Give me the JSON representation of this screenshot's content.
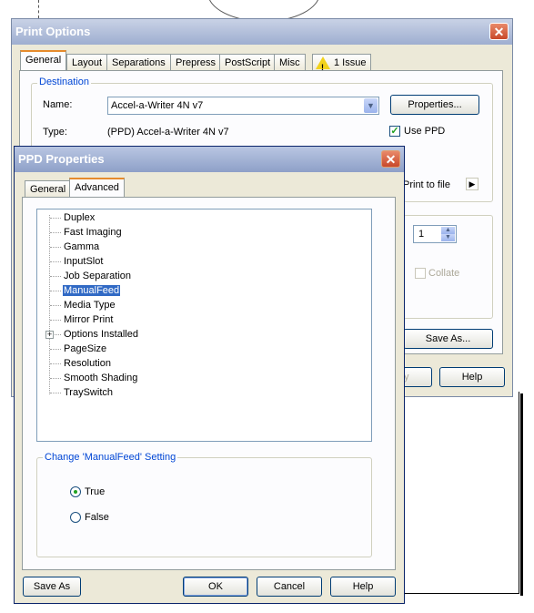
{
  "print_options": {
    "title": "Print Options",
    "tabs": [
      "General",
      "Layout",
      "Separations",
      "Prepress",
      "PostScript",
      "Misc"
    ],
    "issue_tab": "1 Issue",
    "destination": {
      "legend": "Destination",
      "name_label": "Name:",
      "name_value": "Accel-a-Writer 4N v7",
      "type_label": "Type:",
      "type_value": "(PPD) Accel-a-Writer 4N v7",
      "properties_button": "Properties...",
      "use_ppd_label": "Use PPD",
      "use_ppd_checked": true,
      "print_to_file_label": "Print to file"
    },
    "copies_value": "1",
    "collate_label": "Collate",
    "save_as_button": "Save As...",
    "partial_button": "y",
    "help_button": "Help"
  },
  "ppd_properties": {
    "title": "PPD Properties",
    "tabs": [
      "General",
      "Advanced"
    ],
    "selected_tab": "Advanced",
    "tree_items": [
      {
        "label": "Duplex",
        "expandable": false,
        "selected": false
      },
      {
        "label": "Fast Imaging",
        "expandable": false,
        "selected": false
      },
      {
        "label": "Gamma",
        "expandable": false,
        "selected": false
      },
      {
        "label": "InputSlot",
        "expandable": false,
        "selected": false
      },
      {
        "label": "Job Separation",
        "expandable": false,
        "selected": false
      },
      {
        "label": "ManualFeed",
        "expandable": false,
        "selected": true
      },
      {
        "label": "Media Type",
        "expandable": false,
        "selected": false
      },
      {
        "label": "Mirror Print",
        "expandable": false,
        "selected": false
      },
      {
        "label": "Options Installed",
        "expandable": true,
        "selected": false
      },
      {
        "label": "PageSize",
        "expandable": false,
        "selected": false
      },
      {
        "label": "Resolution",
        "expandable": false,
        "selected": false
      },
      {
        "label": "Smooth Shading",
        "expandable": false,
        "selected": false
      },
      {
        "label": "TraySwitch",
        "expandable": false,
        "selected": false
      }
    ],
    "setting_group": "Change 'ManualFeed' Setting",
    "options": [
      {
        "label": "True",
        "checked": true
      },
      {
        "label": "False",
        "checked": false
      }
    ],
    "buttons": {
      "save_as": "Save As",
      "ok": "OK",
      "cancel": "Cancel",
      "help": "Help"
    }
  },
  "colors": {
    "selection": "#316ac5",
    "group_label": "#0046d5",
    "tab_highlight": "#e68b2c"
  }
}
